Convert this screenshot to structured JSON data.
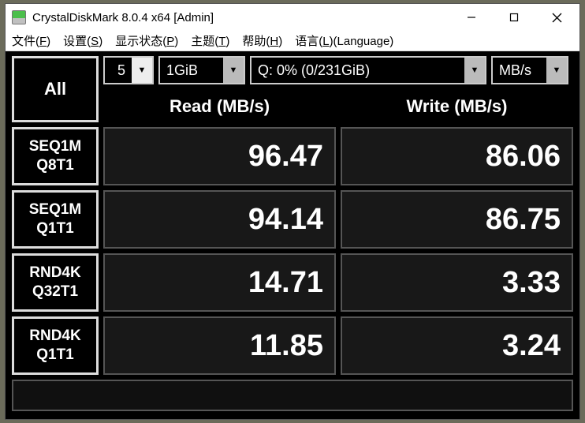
{
  "window": {
    "title": "CrystalDiskMark 8.0.4 x64 [Admin]"
  },
  "menu": {
    "file": "文件(",
    "file_u": "F",
    "file_end": ")",
    "settings": "设置(",
    "settings_u": "S",
    "settings_end": ")",
    "display": "显示状态(",
    "display_u": "P",
    "display_end": ")",
    "theme": "主题(",
    "theme_u": "T",
    "theme_end": ")",
    "help": "帮助(",
    "help_u": "H",
    "help_end": ")",
    "lang": "语言(",
    "lang_u": "L",
    "lang_end": ")(Language)"
  },
  "controls": {
    "all": "All",
    "count": "5",
    "size": "1GiB",
    "drive": "Q: 0% (0/231GiB)",
    "unit": "MB/s"
  },
  "headers": {
    "read": "Read (MB/s)",
    "write": "Write (MB/s)"
  },
  "tests": [
    {
      "l1": "SEQ1M",
      "l2": "Q8T1",
      "read": "96.47",
      "write": "86.06"
    },
    {
      "l1": "SEQ1M",
      "l2": "Q1T1",
      "read": "94.14",
      "write": "86.75"
    },
    {
      "l1": "RND4K",
      "l2": "Q32T1",
      "read": "14.71",
      "write": "3.33"
    },
    {
      "l1": "RND4K",
      "l2": "Q1T1",
      "read": "11.85",
      "write": "3.24"
    }
  ],
  "chart_data": {
    "type": "table",
    "title": "CrystalDiskMark 8.0.4 x64 — Q: drive",
    "columns": [
      "Test",
      "Read (MB/s)",
      "Write (MB/s)"
    ],
    "rows": [
      [
        "SEQ1M Q8T1",
        96.47,
        86.06
      ],
      [
        "SEQ1M Q1T1",
        94.14,
        86.75
      ],
      [
        "RND4K Q32T1",
        14.71,
        3.33
      ],
      [
        "RND4K Q1T1",
        11.85,
        3.24
      ]
    ],
    "params": {
      "runs": 5,
      "block_size": "1GiB",
      "drive": "Q: 0% (0/231GiB)",
      "unit": "MB/s"
    }
  }
}
